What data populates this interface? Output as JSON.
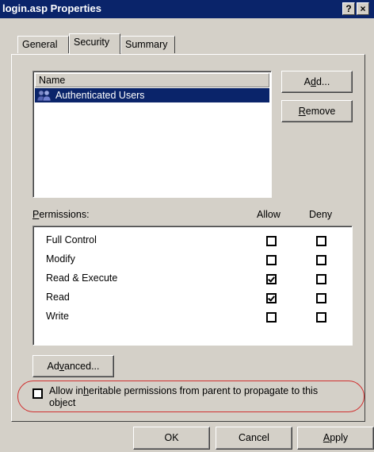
{
  "window": {
    "title": "login.asp Properties",
    "help_button": "?",
    "close_button": "×"
  },
  "tabs": [
    {
      "label": "General"
    },
    {
      "label": "Security"
    },
    {
      "label": "Summary"
    }
  ],
  "users": {
    "header": "Name",
    "items": [
      {
        "name": "Authenticated Users",
        "selected": true,
        "icon": "users-group-icon"
      }
    ],
    "add_pre": "A",
    "add_ul": "d",
    "add_post": "d...",
    "remove_ul": "R",
    "remove_post": "emove"
  },
  "permissions": {
    "label_ul": "P",
    "label_post": "ermissions:",
    "allow_header": "Allow",
    "deny_header": "Deny",
    "rows": [
      {
        "name": "Full Control",
        "allow": false,
        "deny": false
      },
      {
        "name": "Modify",
        "allow": false,
        "deny": false
      },
      {
        "name": "Read & Execute",
        "allow": true,
        "deny": false
      },
      {
        "name": "Read",
        "allow": true,
        "deny": false
      },
      {
        "name": "Write",
        "allow": false,
        "deny": false
      }
    ]
  },
  "advanced": {
    "pre": "Ad",
    "ul": "v",
    "post": "anced..."
  },
  "inherit": {
    "checked": false,
    "line1_pre": "Allow in",
    "line1_ul": "h",
    "line1_post": "eritable permissions from parent to propagate to this",
    "line2": "object"
  },
  "footer": {
    "ok": "OK",
    "cancel": "Cancel",
    "apply_ul": "A",
    "apply_post": "pply"
  },
  "colors": {
    "title_bg": "#0a246a",
    "dialog_bg": "#d4d0c8",
    "callout": "#d03030"
  }
}
